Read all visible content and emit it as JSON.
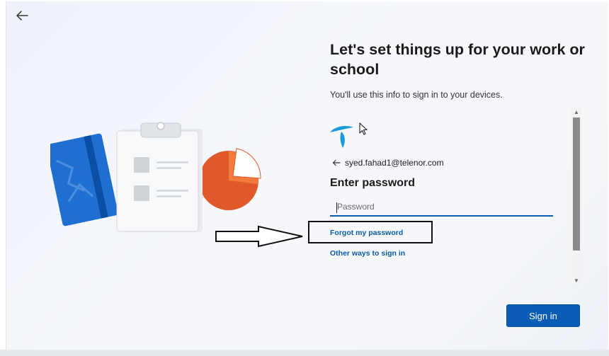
{
  "header": {
    "back_icon": "back-arrow-icon"
  },
  "content": {
    "title": "Let's set things up for your work or school",
    "subtitle": "You'll use this info to sign in to your devices.",
    "logo_icon": "telenor-logo-icon",
    "identity": {
      "back_icon": "back-arrow-icon",
      "email": "syed.fahad1@telenor.com"
    },
    "heading": "Enter password",
    "password_field": {
      "placeholder": "Password",
      "value": ""
    },
    "forgot_link": "Forgot my password",
    "other_ways_link": "Other ways to sign in"
  },
  "footer": {
    "signin_label": "Sign in"
  },
  "colors": {
    "accent": "#0b5cb5",
    "link": "#0b5aa8",
    "brand_logo": "#1a9ad9"
  }
}
